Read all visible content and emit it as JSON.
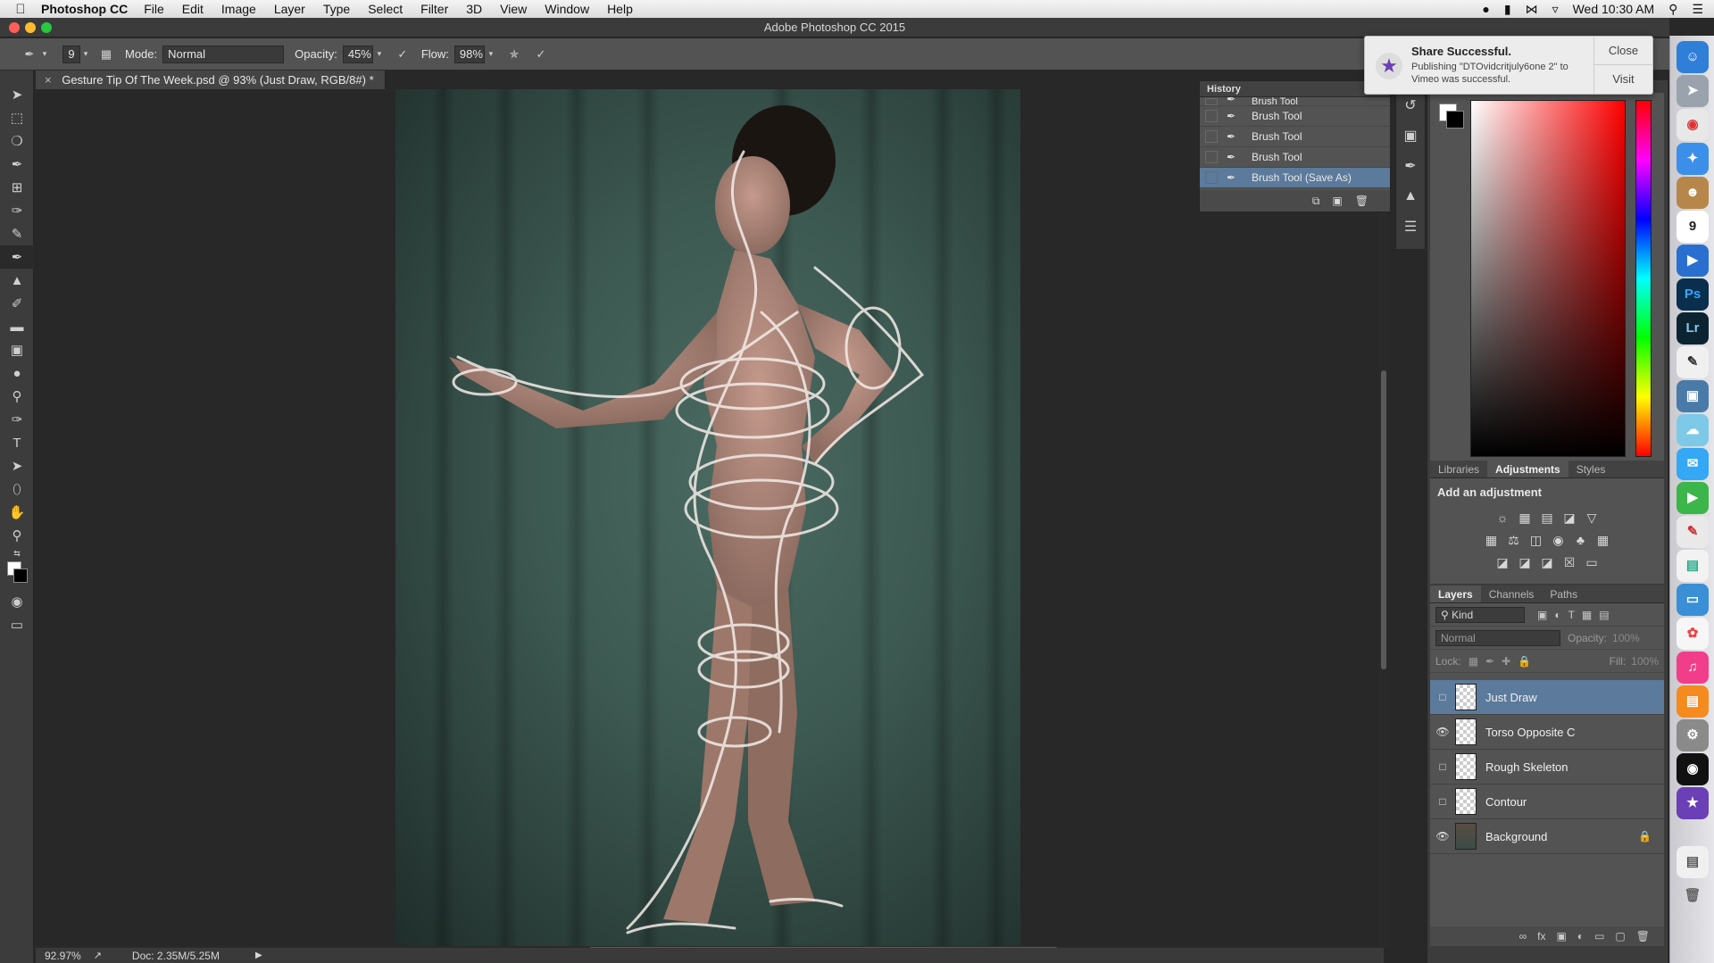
{
  "menubar": {
    "app": "Photoshop CC",
    "items": [
      "File",
      "Edit",
      "Image",
      "Layer",
      "Type",
      "Select",
      "Filter",
      "3D",
      "View",
      "Window",
      "Help"
    ],
    "clock": "Wed 10:30 AM"
  },
  "window": {
    "title": "Adobe Photoshop CC 2015"
  },
  "options": {
    "brush_size": "9",
    "mode_label": "Mode:",
    "mode_value": "Normal",
    "opacity_label": "Opacity:",
    "opacity_value": "45%",
    "flow_label": "Flow:",
    "flow_value": "98%"
  },
  "document": {
    "tab": "Gesture Tip Of The Week.psd @ 93% (Just Draw, RGB/8#) *"
  },
  "status": {
    "zoom": "92.97%",
    "doc": "Doc: 2.35M/5.25M"
  },
  "history": {
    "title": "History",
    "items": [
      {
        "label": "Brush Tool",
        "selected": false
      },
      {
        "label": "Brush Tool",
        "selected": false
      },
      {
        "label": "Brush Tool",
        "selected": false
      },
      {
        "label": "Brush Tool",
        "selected": false
      },
      {
        "label": "Brush Tool (Save As)",
        "selected": true
      }
    ]
  },
  "notification": {
    "title": "Share Successful.",
    "body": "Publishing \"DTOvidcritjuly6one 2\" to Vimeo was successful.",
    "close": "Close",
    "visit": "Visit"
  },
  "adjustments": {
    "tabs": [
      "Libraries",
      "Adjustments",
      "Styles"
    ],
    "active_tab": "Adjustments",
    "heading": "Add an adjustment"
  },
  "layers": {
    "tabs": [
      "Layers",
      "Channels",
      "Paths"
    ],
    "filter": "Kind",
    "blend": "Normal",
    "opacity_label": "Opacity:",
    "opacity_value": "100%",
    "lock_label": "Lock:",
    "fill_label": "Fill:",
    "fill_value": "100%",
    "items": [
      {
        "name": "Just Draw",
        "visible": false,
        "selected": true
      },
      {
        "name": "Torso Opposite C",
        "visible": true,
        "selected": false
      },
      {
        "name": "Rough Skeleton",
        "visible": false,
        "selected": false
      },
      {
        "name": "Contour",
        "visible": false,
        "selected": false
      },
      {
        "name": "Background",
        "visible": true,
        "selected": false,
        "locked": true
      }
    ]
  },
  "dock": {
    "photoshop": "Ps",
    "lightroom": "Lr",
    "calendar_day": "9"
  },
  "colors": {
    "selection": "#5c7a9b",
    "panel": "#535353",
    "backdrop": "#3d5a52"
  }
}
